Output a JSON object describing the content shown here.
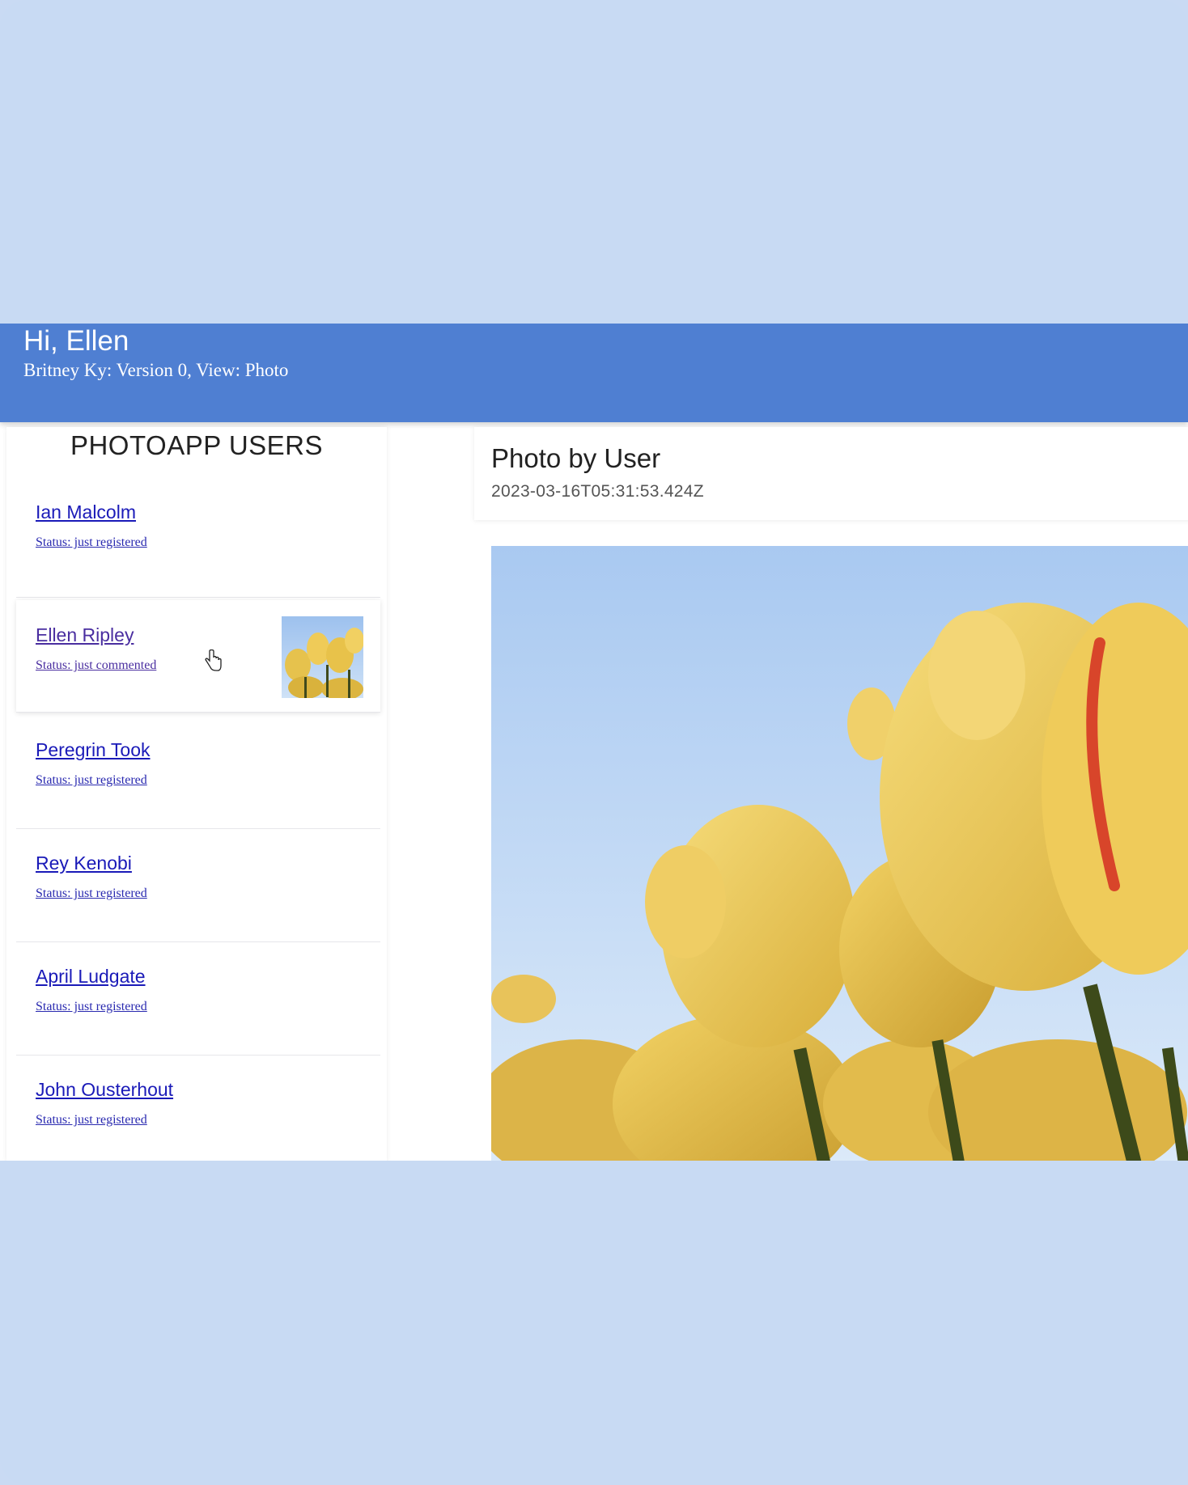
{
  "header": {
    "greeting": "Hi, Ellen",
    "subtitle": "Britney Ky: Version 0, View: Photo"
  },
  "sidebar": {
    "title": "PHOTOAPP USERS",
    "users": [
      {
        "name": "Ian Malcolm",
        "status": "Status: just registered"
      },
      {
        "name": "Ellen Ripley",
        "status": "Status: just commented"
      },
      {
        "name": "Peregrin Took",
        "status": "Status: just registered"
      },
      {
        "name": "Rey Kenobi",
        "status": "Status: just registered"
      },
      {
        "name": "April Ludgate",
        "status": "Status: just registered"
      },
      {
        "name": "John Ousterhout",
        "status": "Status: just registered"
      }
    ]
  },
  "main": {
    "title": "Photo by User",
    "date": "2023-03-16T05:31:53.424Z"
  },
  "colors": {
    "header_bg": "#4f7fd2",
    "page_bg": "#c8daf3",
    "link": "#1a1ab8"
  },
  "icons": {
    "cursor": "hand-pointer-icon"
  }
}
